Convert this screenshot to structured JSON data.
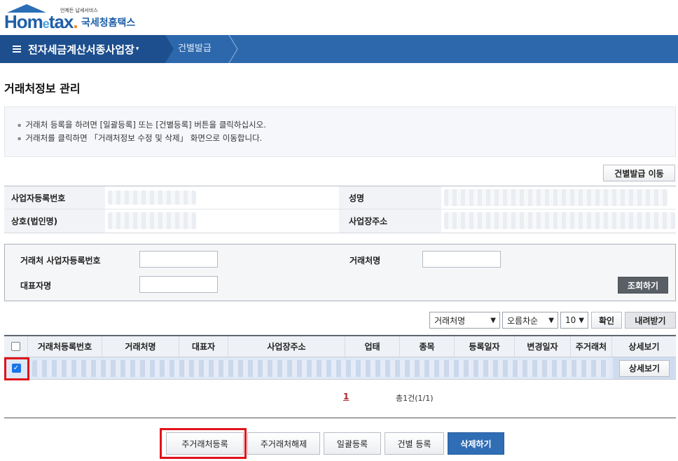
{
  "header": {
    "logo_word": "Hom",
    "logo_e": "e",
    "logo_rest": "tax",
    "logo_tag": "언제든 납세서비스",
    "logo_kr": "국세청홈택스",
    "brand_color": "#2d68ad"
  },
  "nav": {
    "menu_title": "전자세금계산서종사업장",
    "crumb": "건별발급"
  },
  "page": {
    "title": "거래처정보 관리"
  },
  "notice": [
    "거래처 등록을 하려면 [일괄등록] 또는 [건별등록] 버튼을 클릭하십시오.",
    "거래처를 클릭하면 「거래처정보 수정 및 삭제」 화면으로 이동합니다."
  ],
  "buttons": {
    "single_issue_move": "건별발급 이동",
    "search": "조회하기",
    "confirm": "확인",
    "download": "내려받기",
    "detail": "상세보기",
    "register_main": "주거래처등록",
    "release_main": "주거래처해제",
    "bulk_register": "일괄등록",
    "single_register": "건별 등록",
    "delete": "삭제하기"
  },
  "info": {
    "biz_no_label": "사업자등록번호",
    "name_label": "성명",
    "company_label": "상호(법인명)",
    "address_label": "사업장주소"
  },
  "search": {
    "partner_biz_no_label": "거래처 사업자등록번호",
    "partner_name_label": "거래처명",
    "rep_label": "대표자명",
    "partner_biz_no_value": "",
    "partner_name_value": "",
    "rep_value": ""
  },
  "toolbar": {
    "sort_field": "거래처명",
    "sort_order": "오름차순",
    "page_size": "10"
  },
  "grid": {
    "columns": [
      "거래처등록번호",
      "거래처명",
      "대표자",
      "사업장주소",
      "업태",
      "종목",
      "등록일자",
      "변경일자",
      "주거래처",
      "상세보기"
    ],
    "row_checked": true
  },
  "pagination": {
    "current": "1",
    "total_text": "총1건(1/1)"
  },
  "colors": {
    "accent": "#2d68ad",
    "highlight": "#e0131a",
    "selected_row": "#dfe8f6"
  }
}
